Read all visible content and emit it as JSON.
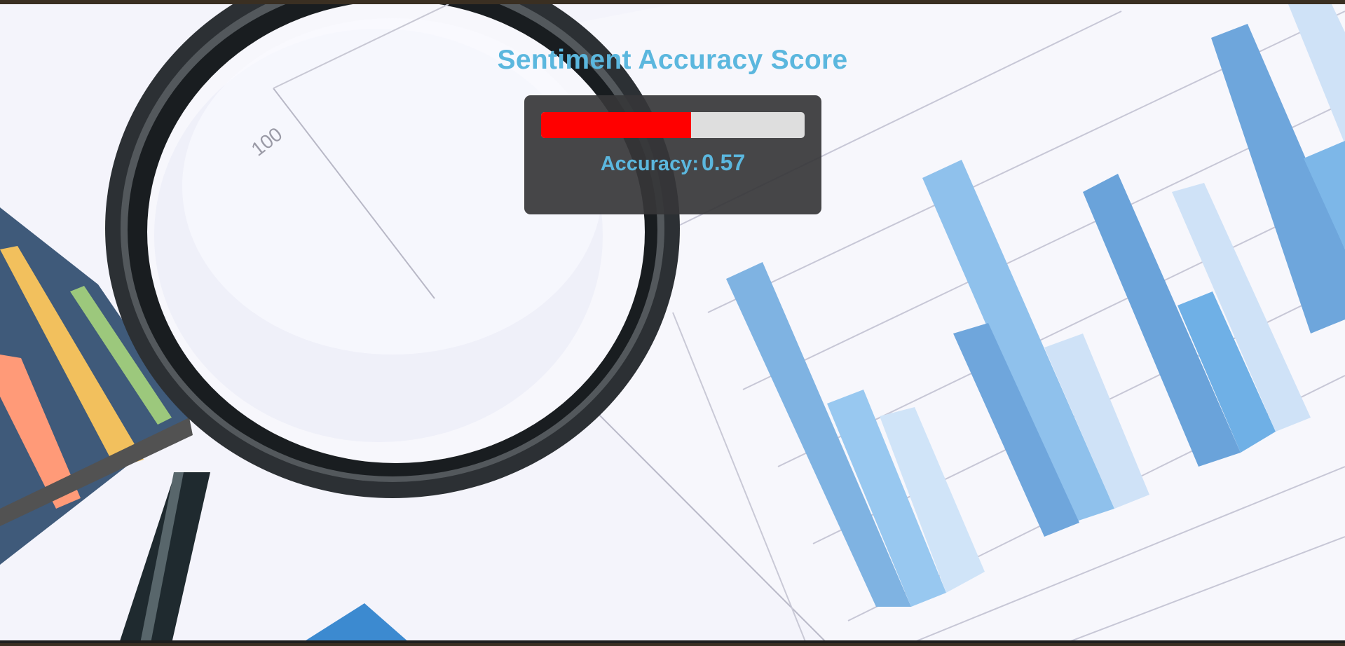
{
  "header": {
    "title": "Sentiment Accuracy Score"
  },
  "score": {
    "label": "Accuracy:",
    "value": "0.57",
    "fraction": 0.57,
    "fill_color": "#ff0000",
    "track_color": "#dedede"
  },
  "background": {
    "paper_label": "100",
    "icons": [
      "magnifying-glass-icon"
    ]
  },
  "colors": {
    "title": "#5bb7de",
    "panel": "#363638"
  }
}
